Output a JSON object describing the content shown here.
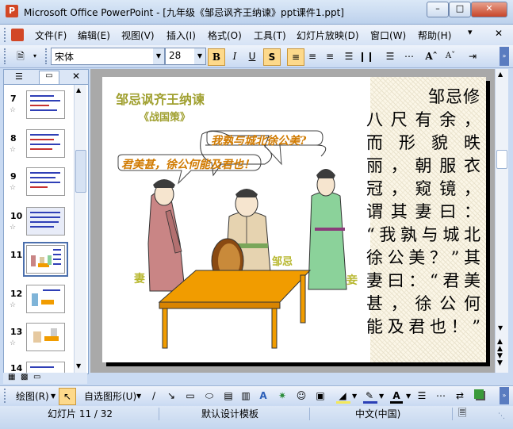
{
  "window": {
    "title": "Microsoft Office PowerPoint - [九年级《邹忌讽齐王纳谏》ppt课件1.ppt]"
  },
  "menu": [
    "文件(F)",
    "编辑(E)",
    "视图(V)",
    "插入(I)",
    "格式(O)",
    "工具(T)",
    "幻灯片放映(D)",
    "窗口(W)",
    "帮助(H)"
  ],
  "toolbar": {
    "font": "宋体",
    "size": "28"
  },
  "thumbnails": [
    {
      "num": "7"
    },
    {
      "num": "8"
    },
    {
      "num": "9"
    },
    {
      "num": "10"
    },
    {
      "num": "11"
    },
    {
      "num": "12"
    },
    {
      "num": "13"
    },
    {
      "num": "14"
    }
  ],
  "slide": {
    "title": "邹忌讽齐王纳谏",
    "subtitle": "《战国策》",
    "bubble1": "我孰与城北徐公美?",
    "bubble2": "君美甚，徐公何能及君也！",
    "label_wife": "妻",
    "label_zouji": "邹忌",
    "label_concubine": "妾",
    "body": [
      "邹忌修",
      "八尺有余，",
      "而形貌昳",
      "丽，朝服衣",
      "冠，窥镜，",
      "谓其妻曰：",
      "“我孰与城北",
      "徐公美？”其",
      "妻曰：“君美",
      "甚，徐公何",
      "能及君也！”"
    ]
  },
  "drawbar": {
    "draw": "绘图(R)",
    "autoshapes": "自选图形(U)"
  },
  "status": {
    "slide": "幻灯片 11 / 32",
    "template": "默认设计模板",
    "language": "中文(中国)"
  }
}
